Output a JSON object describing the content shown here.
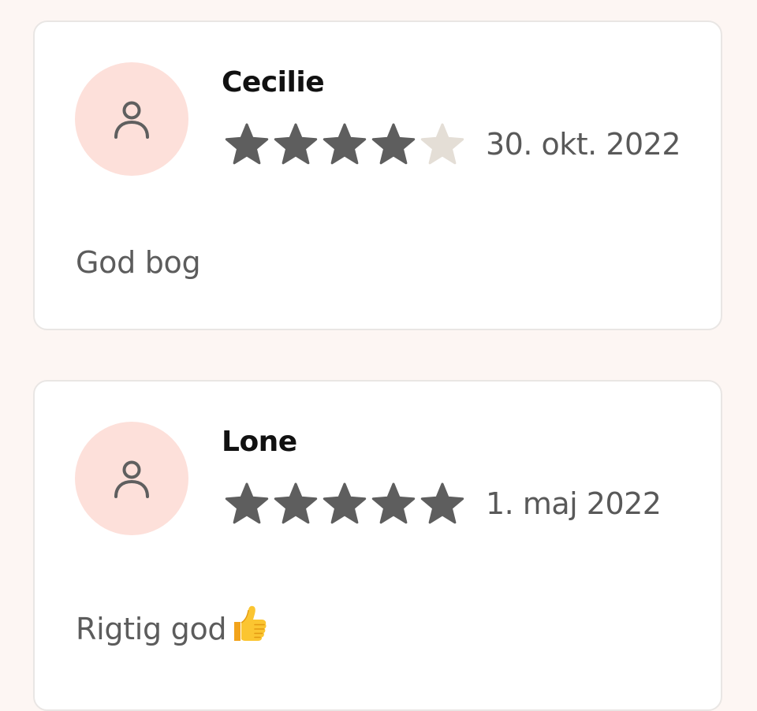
{
  "colors": {
    "page_background": "#fdf6f3",
    "card_background": "#ffffff",
    "card_border": "#e9e6e4",
    "avatar_background": "#fde0da",
    "avatar_icon": "#5f5f5f",
    "star_filled": "#5e5e5e",
    "star_empty": "#e4ded6",
    "name_text": "#111111",
    "secondary_text": "#5c5c5c"
  },
  "reviews": [
    {
      "reviewer_name": "Cecilie",
      "avatar_icon": "user-outline-icon",
      "rating": 4,
      "max_rating": 5,
      "date": "30. okt. 2022",
      "text": "God bog",
      "emoji_icon": ""
    },
    {
      "reviewer_name": "Lone",
      "avatar_icon": "user-outline-icon",
      "rating": 5,
      "max_rating": 5,
      "date": "1. maj 2022",
      "text": "Rigtig god",
      "emoji_icon": "thumbs-up-emoji"
    }
  ]
}
